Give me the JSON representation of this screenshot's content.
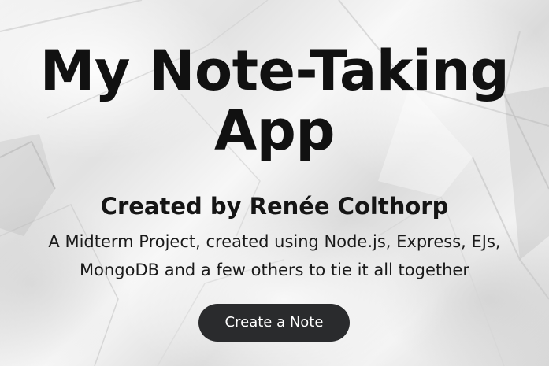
{
  "hero": {
    "title_line1": "My Note-Taking",
    "title_line2": "App",
    "subtitle": "Created by Renée Colthorp",
    "description_line1": "A Midterm Project, created using Node.js, Express, EJs,",
    "description_line2": "MongoDB and a few others to tie it all together",
    "cta_label": "Create a Note"
  },
  "colors": {
    "text": "#111111",
    "button_bg": "#2a2b2d",
    "button_text": "#ffffff"
  }
}
